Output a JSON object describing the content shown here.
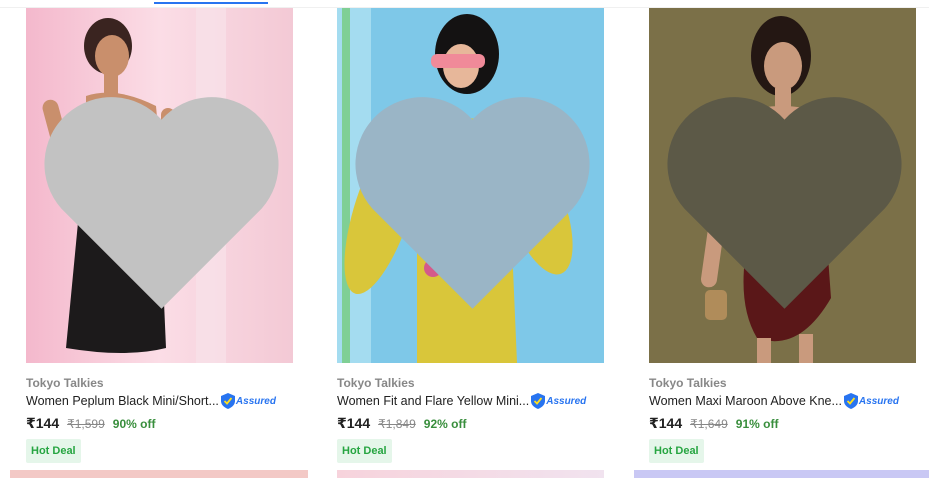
{
  "products": [
    {
      "brand": "Tokyo Talkies",
      "title": "Women Peplum Black Mini/Short...",
      "assured": "Assured",
      "price": "₹144",
      "mrp": "₹1,599",
      "discount": "90% off",
      "deal": "Hot Deal",
      "image_colors": {
        "bg": "#f2c6d6",
        "dress": "#1c1a1b"
      }
    },
    {
      "brand": "Tokyo Talkies",
      "title": "Women Fit and Flare Yellow Mini...",
      "assured": "Assured",
      "price": "₹144",
      "mrp": "₹1,849",
      "discount": "92% off",
      "deal": "Hot Deal",
      "image_colors": {
        "bg": "#7ec8e8",
        "dress": "#d9c63a"
      }
    },
    {
      "brand": "Tokyo Talkies",
      "title": "Women Maxi Maroon Above Kne...",
      "assured": "Assured",
      "price": "₹144",
      "mrp": "₹1,649",
      "discount": "91% off",
      "deal": "Hot Deal",
      "image_colors": {
        "bg": "#7b7048",
        "dress": "#5a1718"
      }
    }
  ],
  "colors": {
    "accent": "#2874f0",
    "discount": "#388e3c",
    "deal_bg": "#e5f6ea",
    "deal_text": "#26a541",
    "wishlist": "#c2c2c2"
  }
}
